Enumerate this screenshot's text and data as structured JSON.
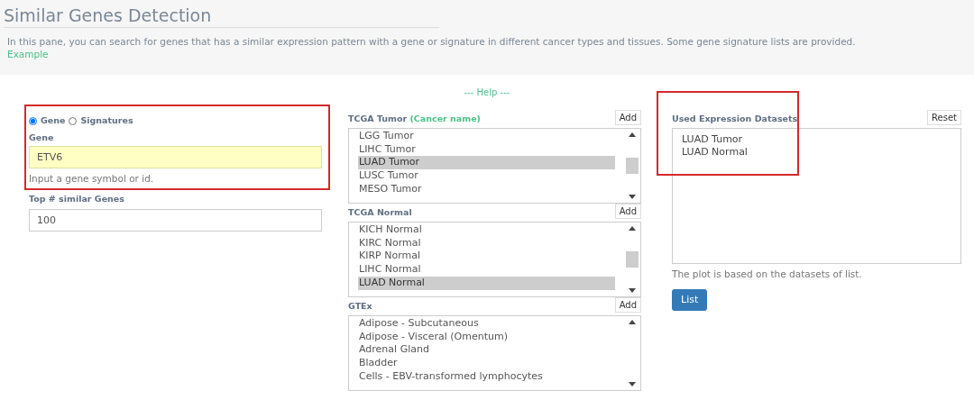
{
  "header": {
    "title": "Similar Genes Detection",
    "description": "In this pane, you can search for genes that has a similar expression pattern with a gene or signature in different cancer types and tissues. Some gene signature lists are provided.",
    "example_link": "Example"
  },
  "help_link": "--- Help ---",
  "query": {
    "modes": [
      {
        "label": "Gene",
        "selected": true
      },
      {
        "label": "Signatures",
        "selected": false
      }
    ],
    "gene_label": "Gene",
    "gene_value": "ETV6",
    "gene_hint": "Input a gene symbol or id.",
    "top_label": "Top # similar Genes",
    "top_value": "100",
    "highlighted": true
  },
  "dataset_lists": [
    {
      "title": "TCGA Tumor",
      "subtitle": "(Cancer name)",
      "add_button": "Add",
      "items": [
        {
          "label": "LGG Tumor",
          "selected": false
        },
        {
          "label": "LIHC Tumor",
          "selected": false
        },
        {
          "label": "LUAD Tumor",
          "selected": true
        },
        {
          "label": "LUSC Tumor",
          "selected": false
        },
        {
          "label": "MESO Tumor",
          "selected": false
        }
      ]
    },
    {
      "title": "TCGA Normal",
      "add_button": "Add",
      "items": [
        {
          "label": "KICH Normal",
          "selected": false
        },
        {
          "label": "KIRC Normal",
          "selected": false
        },
        {
          "label": "KIRP Normal",
          "selected": false
        },
        {
          "label": "LIHC Normal",
          "selected": false
        },
        {
          "label": "LUAD Normal",
          "selected": true
        }
      ]
    },
    {
      "title": "GTEx",
      "add_button": "Add",
      "items": [
        {
          "label": "Adipose - Subcutaneous",
          "selected": false
        },
        {
          "label": "Adipose - Visceral (Omentum)",
          "selected": false
        },
        {
          "label": "Adrenal Gland",
          "selected": false
        },
        {
          "label": "Bladder",
          "selected": false
        },
        {
          "label": "Cells - EBV-transformed lymphocytes",
          "selected": false
        }
      ]
    }
  ],
  "used_datasets": {
    "title": "Used Expression Datasets",
    "reset_button": "Reset",
    "entries": [
      "LUAD Tumor",
      "LUAD Normal"
    ],
    "note": "The plot is based on the datasets of list.",
    "list_button": "List",
    "highlighted": true
  }
}
